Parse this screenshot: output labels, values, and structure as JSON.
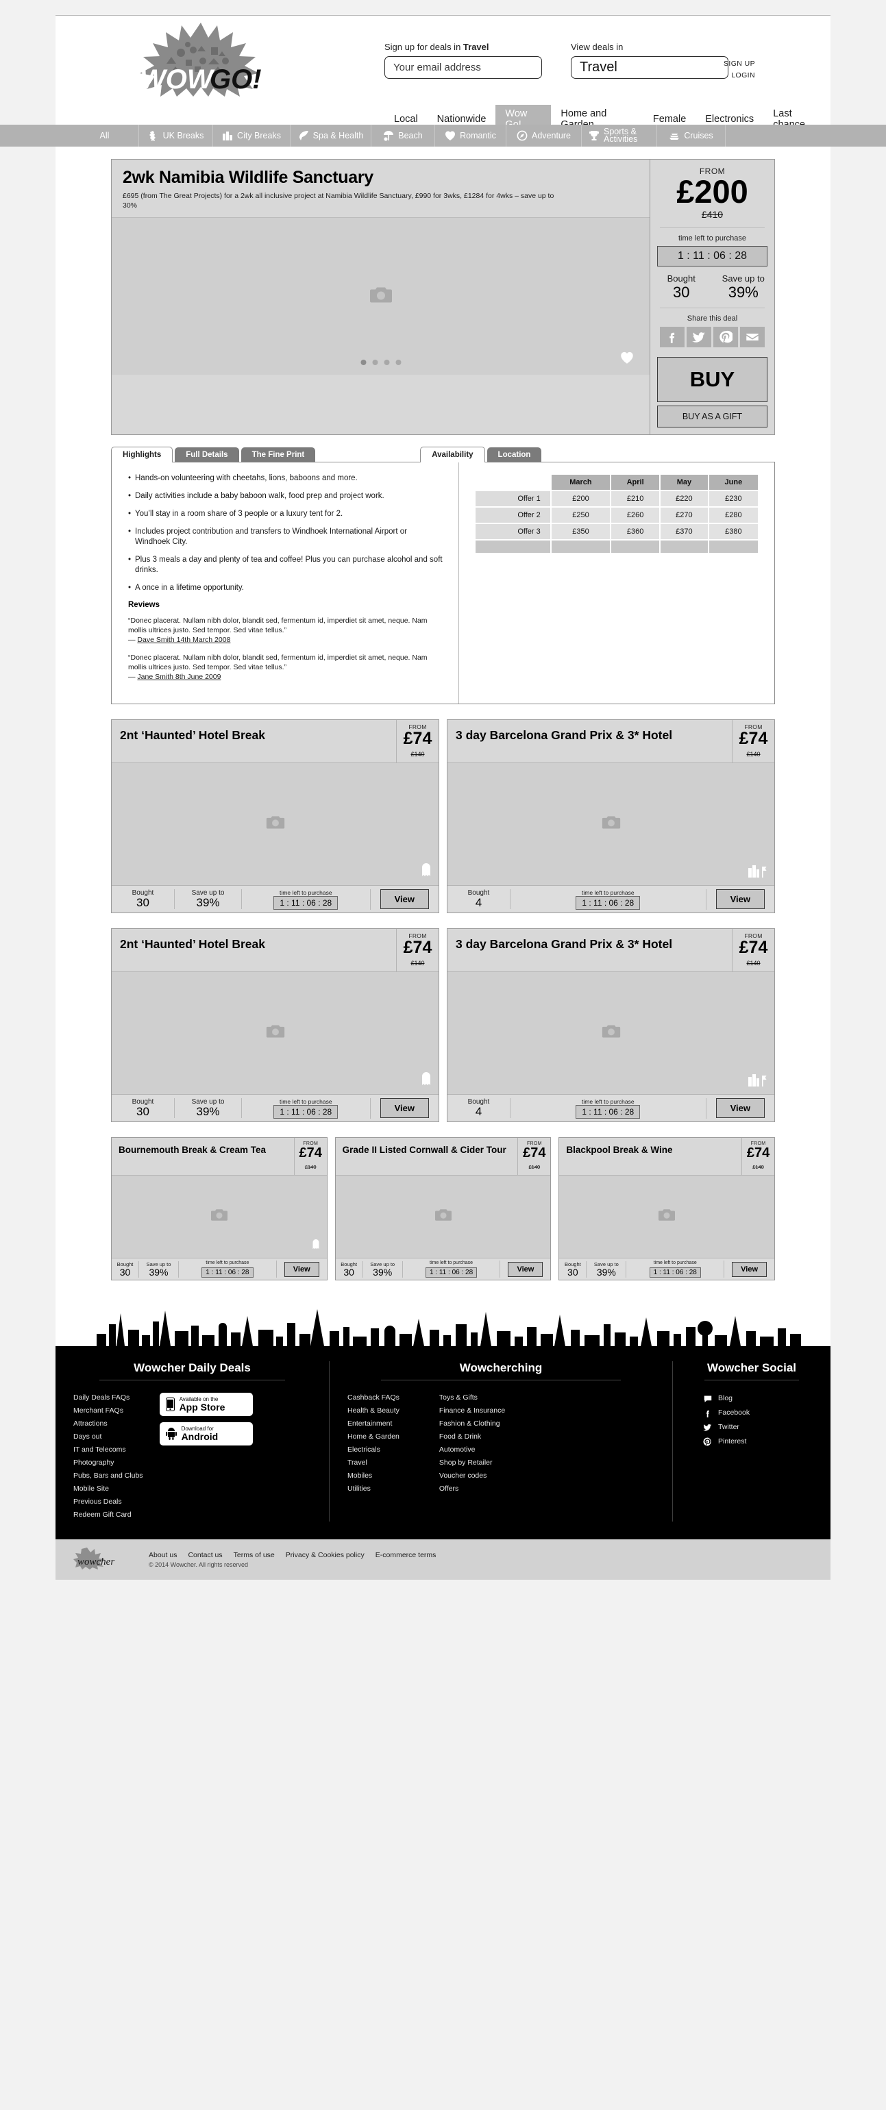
{
  "header": {
    "signup_label_prefix": "Sign up for deals in ",
    "signup_label_strong": "Travel",
    "email_placeholder": "Your email address",
    "viewdeals_label": "View deals in",
    "viewdeals_value": "Travel",
    "signup_link": "SIGN UP",
    "login_link": "LOGIN",
    "logo_text_a": "WOW",
    "logo_text_b": "GO!",
    "nav": [
      {
        "label": "Local",
        "active": false
      },
      {
        "label": "Nationwide",
        "active": false
      },
      {
        "label": "Wow Go!",
        "active": true
      },
      {
        "label": "Home and Garden",
        "active": false
      },
      {
        "label": "Female",
        "active": false
      },
      {
        "label": "Electronics",
        "active": false
      },
      {
        "label": "Last chance",
        "active": false
      }
    ]
  },
  "categories": [
    {
      "label": "All",
      "icon": "none"
    },
    {
      "label": "UK Breaks",
      "icon": "uk-map-icon"
    },
    {
      "label": "City Breaks",
      "icon": "city-buildings-icon"
    },
    {
      "label": "Spa & Health",
      "icon": "leaf-icon"
    },
    {
      "label": "Beach",
      "icon": "parasol-icon"
    },
    {
      "label": "Romantic",
      "icon": "heart-icon"
    },
    {
      "label": "Adventure",
      "icon": "compass-icon"
    },
    {
      "label": "Sports & Activities",
      "icon": "trophy-icon"
    },
    {
      "label": "Cruises",
      "icon": "ship-icon"
    }
  ],
  "main_deal": {
    "title": "2wk Namibia Wildlife Sanctuary",
    "subtitle": "£695 (from The Great Projects) for a 2wk all inclusive project at Namibia Wildlife Sanctuary, £990 for 3wks, £1284 for 4wks – save up to 30%",
    "from_label": "FROM",
    "price": "£200",
    "was_price": "£410",
    "timer_label": "time left to purchase",
    "timer": "1 : 11 : 06 : 28",
    "bought_label": "Bought",
    "bought_value": "30",
    "save_label": "Save up to",
    "save_value": "39%",
    "share_label": "Share this deal",
    "share_icons": [
      "facebook-icon",
      "twitter-icon",
      "pinterest-icon",
      "email-icon"
    ],
    "buy_label": "BUY",
    "gift_label": "BUY AS A GIFT",
    "gallery_dots": 4,
    "gallery_active_dot": 0
  },
  "tabs": [
    {
      "label": "Highlights",
      "active": true
    },
    {
      "label": "Full Details",
      "active": false
    },
    {
      "label": "The Fine Print",
      "active": false
    },
    {
      "label": "Availability",
      "active": true
    },
    {
      "label": "Location",
      "active": false
    }
  ],
  "highlights": [
    "Hands-on volunteering with cheetahs, lions, baboons and more.",
    "Daily activities include a baby baboon walk, food prep and project work.",
    "You’ll stay in a room share of 3 people or a luxury tent for 2.",
    "Includes project contribution and transfers to Windhoek International Airport or Windhoek City.",
    "Plus 3 meals a day and plenty of tea and coffee! Plus you can purchase alcohol and soft drinks.",
    "A once in a lifetime opportunity."
  ],
  "reviews": {
    "heading": "Reviews",
    "items": [
      {
        "quote": "“Donec placerat. Nullam nibh dolor, blandit sed, fermentum id, imperdiet sit amet, neque. Nam mollis ultrices justo. Sed tempor. Sed vitae tellus.”",
        "author": "Dave Smith 14th March 2008"
      },
      {
        "quote": "“Donec placerat. Nullam nibh dolor, blandit sed, fermentum id, imperdiet sit amet, neque. Nam mollis ultrices justo. Sed tempor. Sed vitae tellus.”",
        "author": "Jane Smith 8th June 2009"
      }
    ]
  },
  "availability": {
    "columns": [
      "",
      "March",
      "April",
      "May",
      "June"
    ],
    "rows": [
      {
        "label": "Offer 1",
        "values": [
          "£200",
          "£210",
          "£220",
          "£230"
        ]
      },
      {
        "label": "Offer 2",
        "values": [
          "£250",
          "£260",
          "£270",
          "£280"
        ]
      },
      {
        "label": "Offer 3",
        "values": [
          "£350",
          "£360",
          "£370",
          "£380"
        ]
      }
    ]
  },
  "deal_cards_row1": [
    {
      "title": "2nt ‘Haunted’ Hotel Break",
      "from_label": "FROM",
      "price": "£74",
      "was": "£140",
      "bought_label": "Bought",
      "bought": "30",
      "save_label": "Save up to",
      "save": "39%",
      "timer_label": "time left to purchase",
      "timer": "1 : 11 : 06 : 28",
      "view": "View",
      "corner_icon": "ghost-icon"
    },
    {
      "title": "3 day Barcelona Grand Prix & 3* Hotel",
      "from_label": "FROM",
      "price": "£74",
      "was": "£140",
      "bought_label": "Bought",
      "bought": "4",
      "save_label": "",
      "save": "",
      "timer_label": "time left to purchase",
      "timer": "1 : 11 : 06 : 28",
      "view": "View",
      "corner_icon": "city-flag-icon"
    }
  ],
  "deal_cards_row2": [
    {
      "title": "2nt ‘Haunted’ Hotel Break",
      "from_label": "FROM",
      "price": "£74",
      "was": "£140",
      "bought_label": "Bought",
      "bought": "30",
      "save_label": "Save up to",
      "save": "39%",
      "timer_label": "time left to purchase",
      "timer": "1 : 11 : 06 : 28",
      "view": "View",
      "corner_icon": "ghost-icon"
    },
    {
      "title": "3 day Barcelona Grand Prix & 3* Hotel",
      "from_label": "FROM",
      "price": "£74",
      "was": "£140",
      "bought_label": "Bought",
      "bought": "4",
      "save_label": "",
      "save": "",
      "timer_label": "time left to purchase",
      "timer": "1 : 11 : 06 : 28",
      "view": "View",
      "corner_icon": "city-flag-icon"
    }
  ],
  "deal_cards_row3": [
    {
      "title": "Bournemouth Break & Cream Tea",
      "from_label": "FROM",
      "price": "£74",
      "was": "£140",
      "bought_label": "Bought",
      "bought": "30",
      "save_label": "Save up to",
      "save": "39%",
      "timer_label": "time left to purchase",
      "timer": "1 : 11 : 06 : 28",
      "view": "View",
      "corner_icon": "ghost-icon"
    },
    {
      "title": "Grade II Listed Cornwall & Cider Tour",
      "from_label": "FROM",
      "price": "£74",
      "was": "£140",
      "bought_label": "Bought",
      "bought": "30",
      "save_label": "Save up to",
      "save": "39%",
      "timer_label": "time left to purchase",
      "timer": "1 : 11 : 06 : 28",
      "view": "View",
      "corner_icon": "none"
    },
    {
      "title": "Blackpool Break & Wine",
      "from_label": "FROM",
      "price": "£74",
      "was": "£140",
      "bought_label": "Bought",
      "bought": "30",
      "save_label": "Save up to",
      "save": "39%",
      "timer_label": "time left to purchase",
      "timer": "1 : 11 : 06 : 28",
      "view": "View",
      "corner_icon": "none"
    }
  ],
  "footer": {
    "col1": {
      "heading": "Wowcher Daily Deals",
      "links": [
        "Daily Deals FAQs",
        "Merchant FAQs",
        "Attractions",
        "Days out",
        "IT and Telecoms",
        "Photography",
        "Pubs, Bars and Clubs",
        "Mobile Site",
        "Previous Deals",
        "Redeem Gift Card"
      ],
      "appstore_small": "Available on the",
      "appstore_big": "App Store",
      "android_small": "Download for",
      "android_big": "Android"
    },
    "col2": {
      "heading": "Wowcherching",
      "links_a": [
        "Cashback FAQs",
        "Health & Beauty",
        "Entertainment",
        "Home & Garden",
        "Electricals",
        "Travel",
        "Mobiles",
        "Utilities"
      ],
      "links_b": [
        "Toys & Gifts",
        "Finance & Insurance",
        "Fashion & Clothing",
        "Food & Drink",
        "Automotive",
        "Shop by Retailer",
        "Voucher codes",
        "Offers"
      ]
    },
    "col3": {
      "heading": "Wowcher Social",
      "links": [
        {
          "label": "Blog",
          "icon": "blog-icon"
        },
        {
          "label": "Facebook",
          "icon": "facebook-icon"
        },
        {
          "label": "Twitter",
          "icon": "twitter-icon"
        },
        {
          "label": "Pinterest",
          "icon": "pinterest-icon"
        }
      ]
    },
    "subfooter": {
      "logo_text": "wowcher",
      "links": [
        "About us",
        "Contact us",
        "Terms of use",
        "Privacy & Cookies policy",
        "E-commerce terms"
      ],
      "copyright": "© 2014 Wowcher. All rights reserved"
    }
  }
}
